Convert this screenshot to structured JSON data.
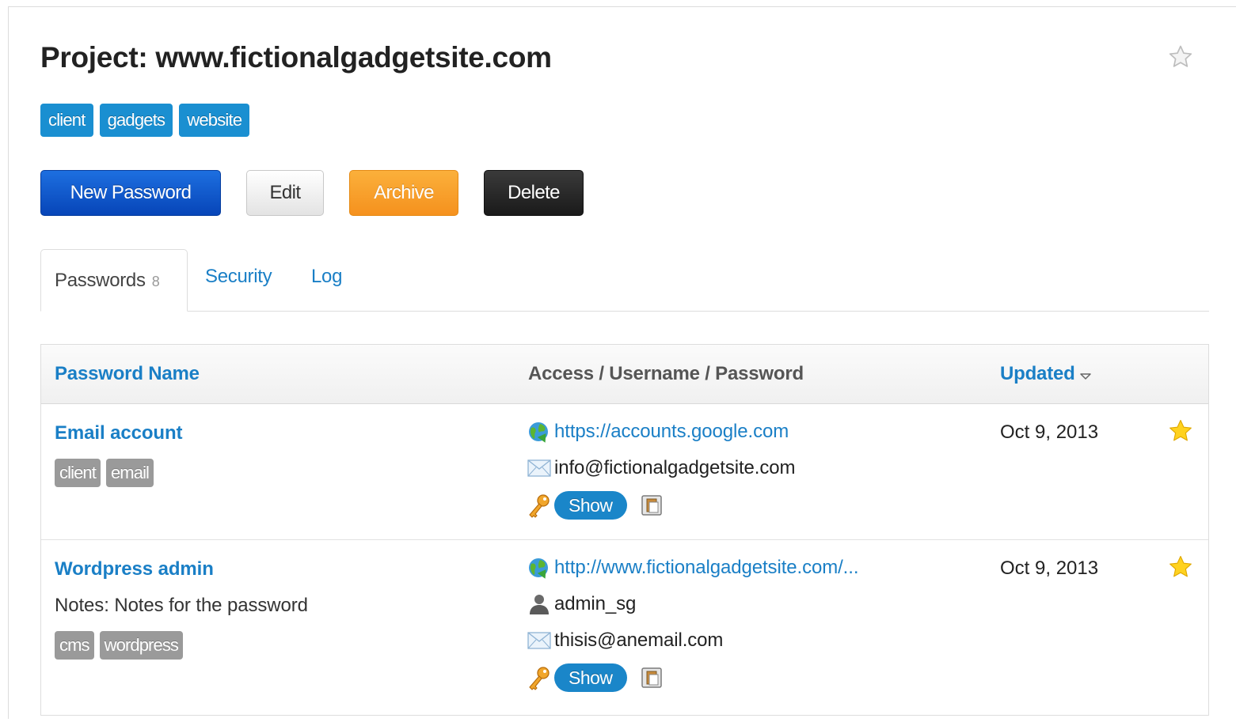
{
  "project": {
    "title": "Project: www.fictionalgadgetsite.com",
    "tags": [
      "client",
      "gadgets",
      "website"
    ]
  },
  "actions": {
    "new_password": "New Password",
    "edit": "Edit",
    "archive": "Archive",
    "delete": "Delete"
  },
  "tabs": {
    "passwords": "Passwords",
    "passwords_count": "8",
    "security": "Security",
    "log": "Log"
  },
  "table": {
    "headers": {
      "name": "Password Name",
      "access": "Access / Username / Password",
      "updated": "Updated"
    },
    "rows": [
      {
        "name": "Email account",
        "notes": "",
        "tags": [
          "client",
          "email"
        ],
        "url": "https://accounts.google.com",
        "username": "",
        "email": "info@fictionalgadgetsite.com",
        "show_label": "Show",
        "updated": "Oct 9, 2013",
        "favorite": true
      },
      {
        "name": "Wordpress admin",
        "notes": "Notes: Notes for the password",
        "tags": [
          "cms",
          "wordpress"
        ],
        "url": "http://www.fictionalgadgetsite.com/...",
        "username": "admin_sg",
        "email": "thisis@anemail.com",
        "show_label": "Show",
        "updated": "Oct 9, 2013",
        "favorite": true
      }
    ]
  },
  "colors": {
    "link": "#1a7fc6",
    "tag_blue": "#1a8fd1",
    "tag_gray": "#9a9a9a",
    "primary": "#0a55cc",
    "archive": "#f7a12b",
    "delete": "#222222",
    "star": "#ffcc00"
  },
  "icons": {
    "project_favorite": "star-outline-icon",
    "row_favorite": "star-filled-icon",
    "url": "globe-icon",
    "username": "user-icon",
    "email": "envelope-icon",
    "password": "key-icon",
    "copy": "clipboard-icon",
    "sort": "sort-down-icon"
  }
}
